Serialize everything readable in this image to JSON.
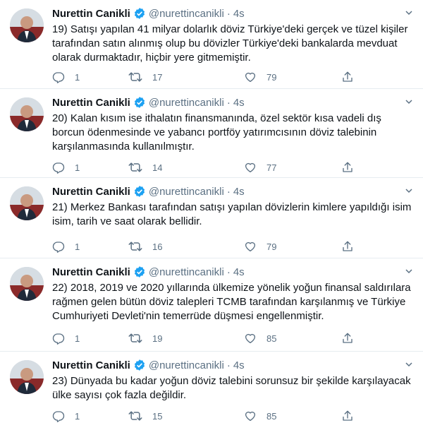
{
  "author": {
    "name": "Nurettin Canikli",
    "handle": "@nurettincanikli",
    "time": "4s",
    "separator": "·"
  },
  "icons": {
    "verified": "verified-badge-icon",
    "more": "more-chevron-icon",
    "reply": "reply-icon",
    "retweet": "retweet-icon",
    "like": "heart-icon",
    "share": "share-icon"
  },
  "colors": {
    "verified": "#1da1f2",
    "muted": "#5b7083",
    "text": "#0f1419",
    "divider": "#e6ecf0"
  },
  "tweets": [
    {
      "text": "19) Satışı yapılan 41 milyar dolarlık döviz Türkiye'deki gerçek ve tüzel kişiler tarafından satın alınmış olup bu dövizler Türkiye'deki bankalarda mevduat olarak durmaktadır, hiçbir yere gitmemiştir.",
      "replies": "1",
      "retweets": "17",
      "likes": "79"
    },
    {
      "text": "20) Kalan kısım ise ithalatın finansmanında, özel sektör kısa vadeli dış borcun ödenmesinde ve yabancı portföy yatırımcısının döviz talebinin karşılanmasında kullanılmıştır.",
      "replies": "1",
      "retweets": "14",
      "likes": "77"
    },
    {
      "text": "21) Merkez Bankası tarafından satışı yapılan dövizlerin kimlere yapıldığı isim isim, tarih ve saat olarak bellidir.",
      "replies": "1",
      "retweets": "16",
      "likes": "79"
    },
    {
      "text": "22) 2018, 2019 ve 2020 yıllarında ülkemize yönelik yoğun finansal saldırılara rağmen gelen bütün döviz talepleri TCMB tarafından karşılanmış ve Türkiye Cumhuriyeti Devleti'nin temerrüde düşmesi engellenmiştir.",
      "replies": "1",
      "retweets": "19",
      "likes": "85"
    },
    {
      "text": "23) Dünyada bu kadar yoğun döviz talebini sorunsuz bir şekilde karşılayacak ülke sayısı çok fazla değildir.",
      "replies": "1",
      "retweets": "15",
      "likes": "85"
    }
  ]
}
